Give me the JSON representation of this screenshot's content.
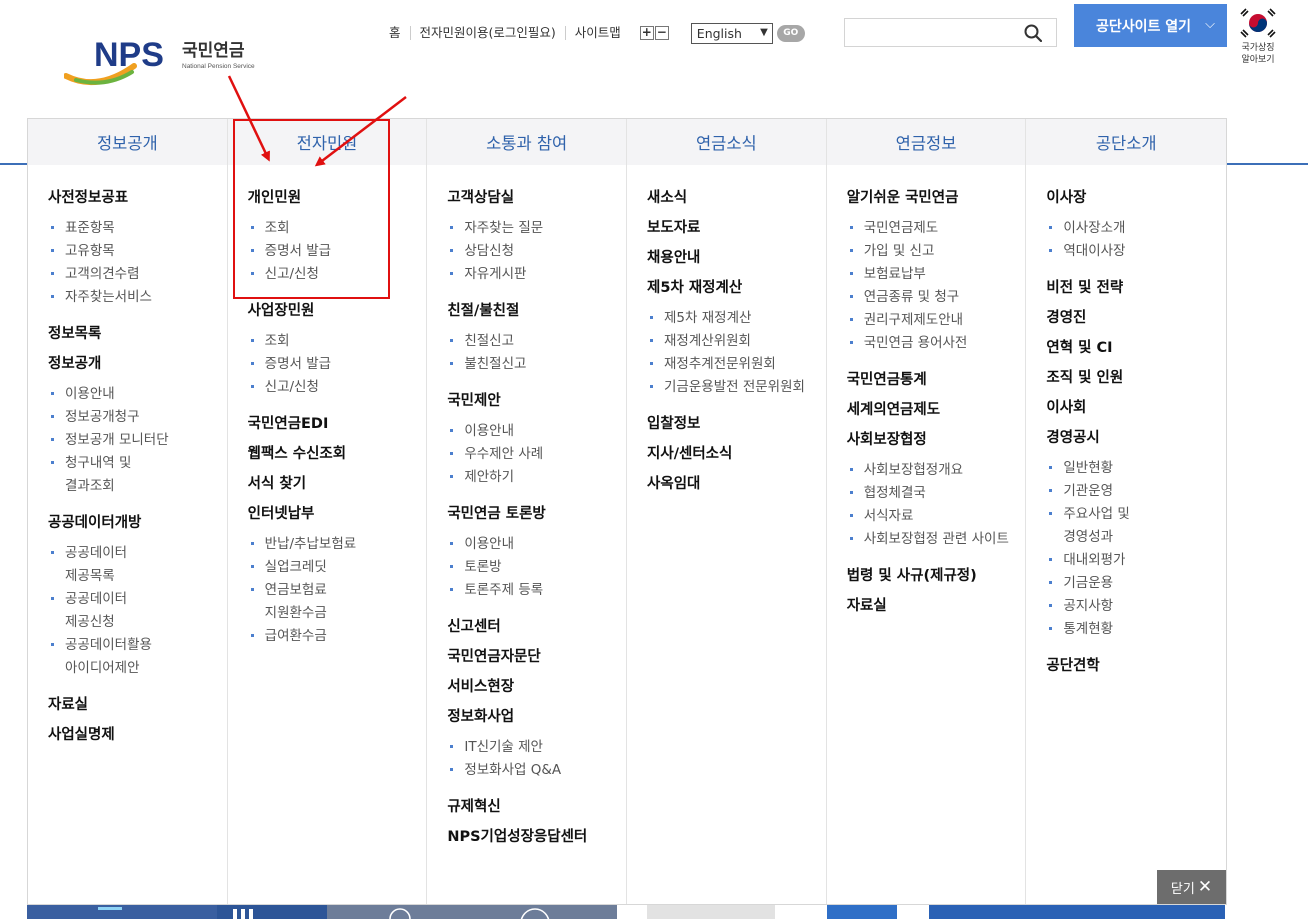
{
  "header": {
    "logo_text": "NPS",
    "logo_kr": "국민연금",
    "logo_en": "National Pension Service",
    "util_links": [
      "홈",
      "전자민원이용(로그인필요)",
      "사이트맵"
    ],
    "zoom_in": "+",
    "zoom_out": "−",
    "language_selected": "English",
    "go_label": "GO",
    "search_value": "",
    "site_button_label": "공단사이트 열기",
    "national_symbol_label_1": "국가상징",
    "national_symbol_label_2": "알아보기",
    "colors": {
      "accent": "#2f62ab",
      "button": "#4a85db",
      "annotation": "#e01010"
    }
  },
  "menu": {
    "close_label": "닫기",
    "columns": [
      {
        "title": "정보공개",
        "groups": [
          {
            "label": "사전정보공표",
            "items": [
              "표준항목",
              "고유항목",
              "고객의견수렴",
              "자주찾는서비스"
            ]
          },
          {
            "label": "정보목록",
            "items": []
          },
          {
            "label": "정보공개",
            "items": [
              "이용안내",
              "정보공개청구",
              "정보공개 모니터단",
              "청구내역 및\n결과조회"
            ]
          },
          {
            "label": "공공데이터개방",
            "items": [
              "공공데이터\n제공목록",
              "공공데이터\n제공신청",
              "공공데이터활용\n아이디어제안"
            ]
          },
          {
            "label": "자료실",
            "items": []
          },
          {
            "label": "사업실명제",
            "items": []
          }
        ]
      },
      {
        "title": "전자민원",
        "groups": [
          {
            "label": "개인민원",
            "items": [
              "조회",
              "증명서 발급",
              "신고/신청"
            ]
          },
          {
            "label": "사업장민원",
            "items": [
              "조회",
              "증명서 발급",
              "신고/신청"
            ]
          },
          {
            "label": "국민연금EDI",
            "items": []
          },
          {
            "label": "웹팩스 수신조회",
            "items": []
          },
          {
            "label": "서식 찾기",
            "items": []
          },
          {
            "label": "인터넷납부",
            "items": [
              "반납/추납보험료",
              "실업크레딧",
              "연금보험료\n지원환수금",
              "급여환수금"
            ]
          }
        ]
      },
      {
        "title": "소통과 참여",
        "groups": [
          {
            "label": "고객상담실",
            "items": [
              "자주찾는 질문",
              "상담신청",
              "자유게시판"
            ]
          },
          {
            "label": "친절/불친절",
            "items": [
              "친절신고",
              "불친절신고"
            ]
          },
          {
            "label": "국민제안",
            "items": [
              "이용안내",
              "우수제안 사례",
              "제안하기"
            ]
          },
          {
            "label": "국민연금 토론방",
            "items": [
              "이용안내",
              "토론방",
              "토론주제 등록"
            ]
          },
          {
            "label": "신고센터",
            "items": []
          },
          {
            "label": "국민연금자문단",
            "items": []
          },
          {
            "label": "서비스현장",
            "items": []
          },
          {
            "label": "정보화사업",
            "items": [
              "IT신기술 제안",
              "정보화사업 Q&A"
            ]
          },
          {
            "label": "규제혁신",
            "items": []
          },
          {
            "label": "NPS기업성장응답센터",
            "items": []
          }
        ]
      },
      {
        "title": "연금소식",
        "groups": [
          {
            "label": "새소식",
            "items": []
          },
          {
            "label": "보도자료",
            "items": []
          },
          {
            "label": "채용안내",
            "items": []
          },
          {
            "label": "제5차 재정계산",
            "items": [
              "제5차 재정계산",
              "재정계산위원회",
              "재정추계전문위원회",
              "기금운용발전 전문위원회"
            ]
          },
          {
            "label": "입찰정보",
            "items": []
          },
          {
            "label": "지사/센터소식",
            "items": []
          },
          {
            "label": "사옥임대",
            "items": []
          }
        ]
      },
      {
        "title": "연금정보",
        "groups": [
          {
            "label": "알기쉬운 국민연금",
            "items": [
              "국민연금제도",
              "가입 및 신고",
              "보험료납부",
              "연금종류 및 청구",
              "권리구제제도안내",
              "국민연금 용어사전"
            ]
          },
          {
            "label": "국민연금통계",
            "items": []
          },
          {
            "label": "세계의연금제도",
            "items": []
          },
          {
            "label": "사회보장협정",
            "items": [
              "사회보장협정개요",
              "협정체결국",
              "서식자료",
              "사회보장협정 관련 사이트"
            ]
          },
          {
            "label": "법령 및 사규(제규정)",
            "items": []
          },
          {
            "label": "자료실",
            "items": []
          }
        ]
      },
      {
        "title": "공단소개",
        "groups": [
          {
            "label": "이사장",
            "items": [
              "이사장소개",
              "역대이사장"
            ]
          },
          {
            "label": "비전 및 전략",
            "items": []
          },
          {
            "label": "경영진",
            "items": []
          },
          {
            "label": "연혁 및 CI",
            "items": []
          },
          {
            "label": "조직 및 인원",
            "items": []
          },
          {
            "label": "이사회",
            "items": []
          },
          {
            "label": "경영공시",
            "items": [
              "일반현황",
              "기관운영",
              "주요사업 및\n경영성과",
              "대내외평가",
              "기금운용",
              "공지사항",
              "통계현황"
            ]
          },
          {
            "label": "공단견학",
            "items": []
          }
        ]
      }
    ]
  }
}
